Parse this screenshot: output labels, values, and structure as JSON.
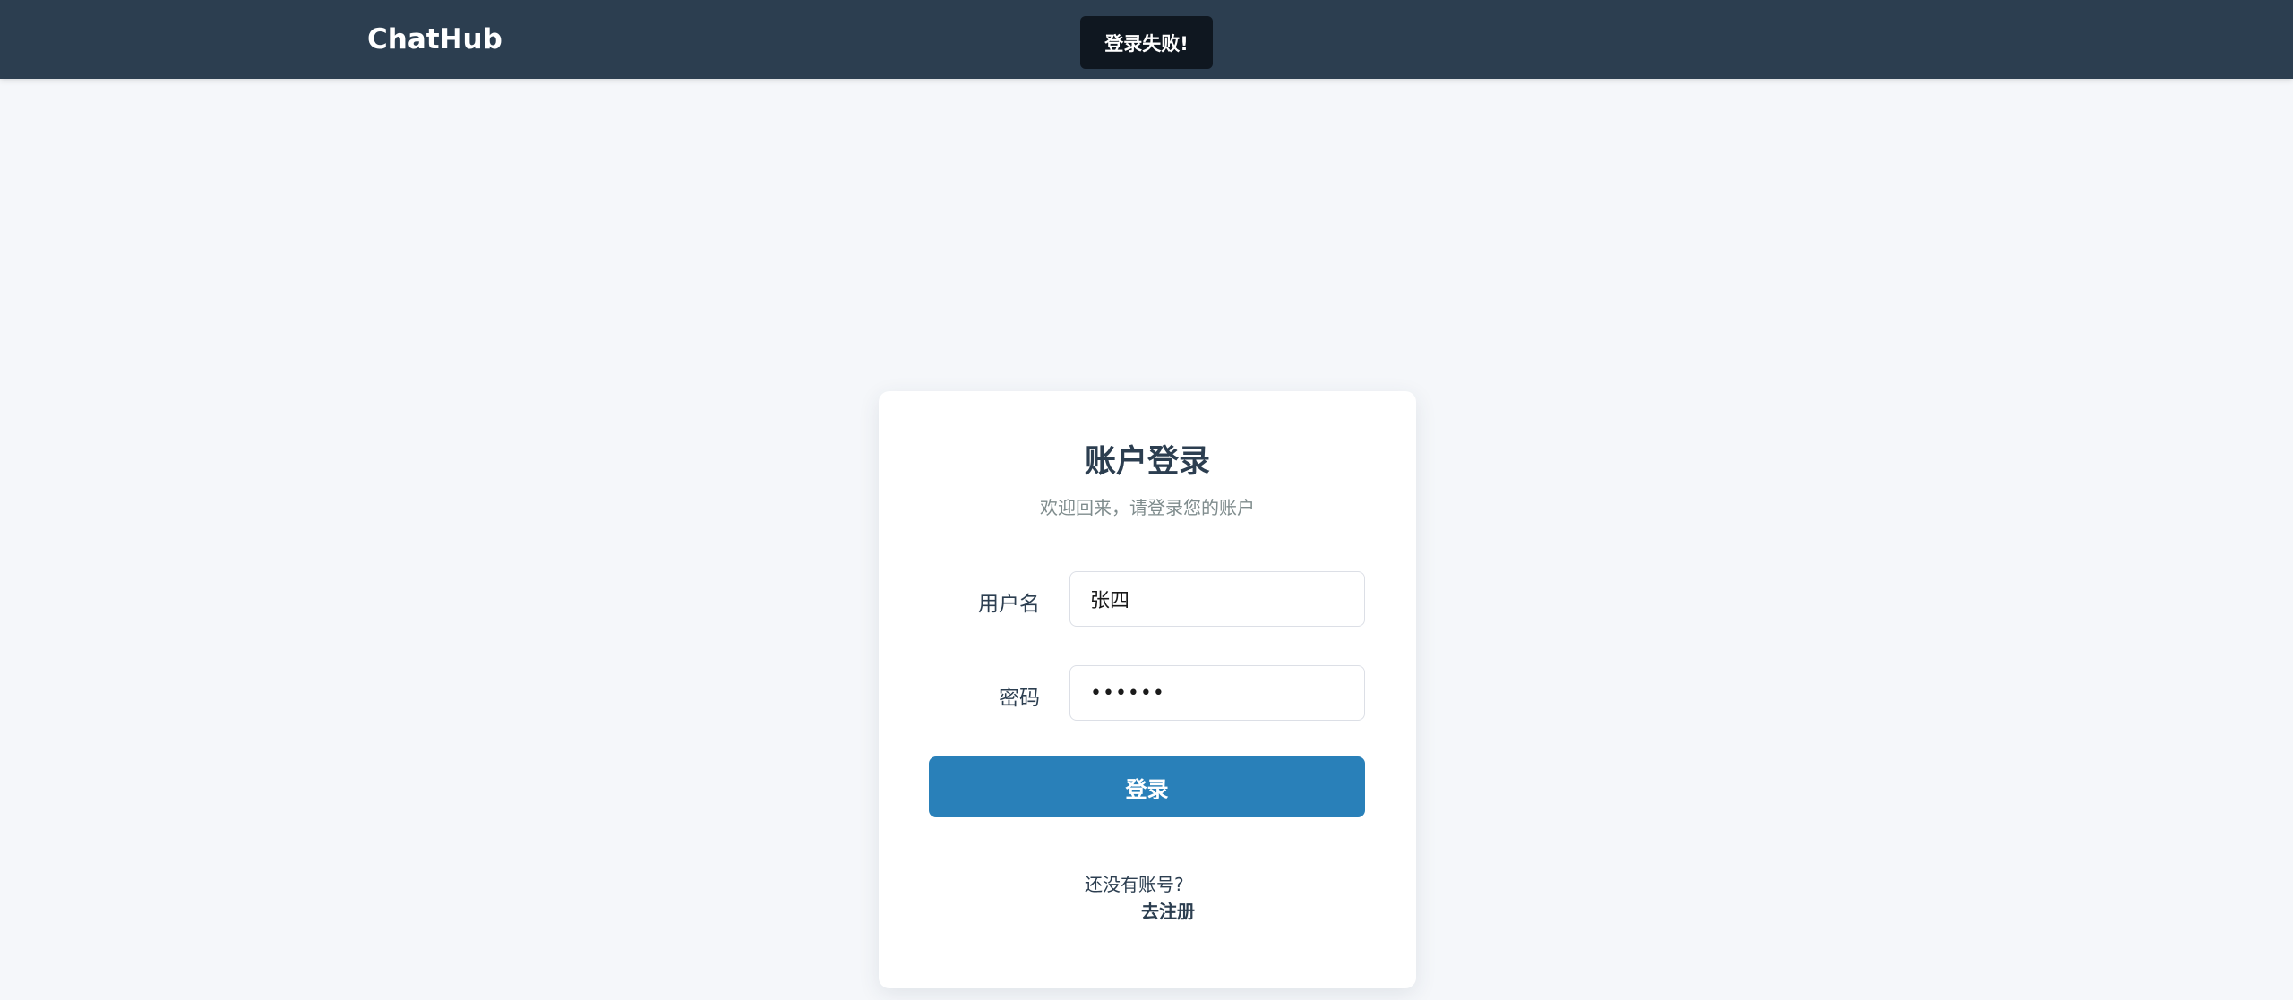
{
  "header": {
    "brand": "ChatHub"
  },
  "toast": {
    "message": "登录失败!"
  },
  "login_card": {
    "title": "账户登录",
    "subtitle": "欢迎回来，请登录您的账户",
    "username_label": "用户名",
    "username_value": "张四",
    "password_label": "密码",
    "password_value": "••••••",
    "submit_label": "登录",
    "no_account_text": "还没有账号?",
    "register_link": "去注册"
  },
  "colors": {
    "header_bg": "#2c3e50",
    "page_bg": "#f5f7fa",
    "primary": "#2980b9",
    "toast_bg": "#0f1720"
  }
}
